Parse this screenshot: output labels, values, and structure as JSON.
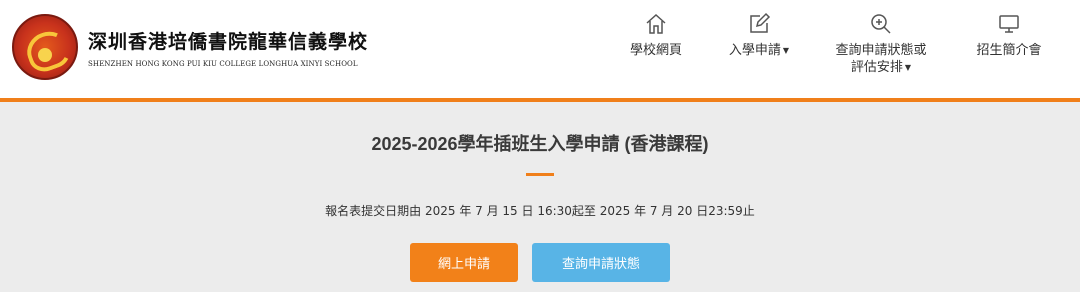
{
  "school": {
    "name_cn": "深圳香港培僑書院龍華信義學校",
    "name_en": "SHENZHEN HONG KONG PUI KIU COLLEGE LONGHUA XINYI SCHOOL"
  },
  "nav": {
    "home": "學校網頁",
    "admission": "入學申請",
    "status_line1": "查詢申請狀態或",
    "status_line2": "評估安排",
    "enrolment": "招生簡介會"
  },
  "icons": {
    "home": "home-icon",
    "admission": "edit-icon",
    "status": "zoom-in-icon",
    "enrolment": "monitor-icon"
  },
  "main": {
    "title": "2025-2026學年插班生入學申請 (香港課程)",
    "period": "報名表提交日期由 2025 年 7 月 15 日 16:30起至 2025 年 7 月 20 日23:59止",
    "apply_button": "網上申請",
    "status_button": "查詢申請狀態"
  },
  "colors": {
    "accent": "#f07f1a",
    "apply_button": "#f28119",
    "status_button": "#58b4e6",
    "background": "#ececec"
  }
}
